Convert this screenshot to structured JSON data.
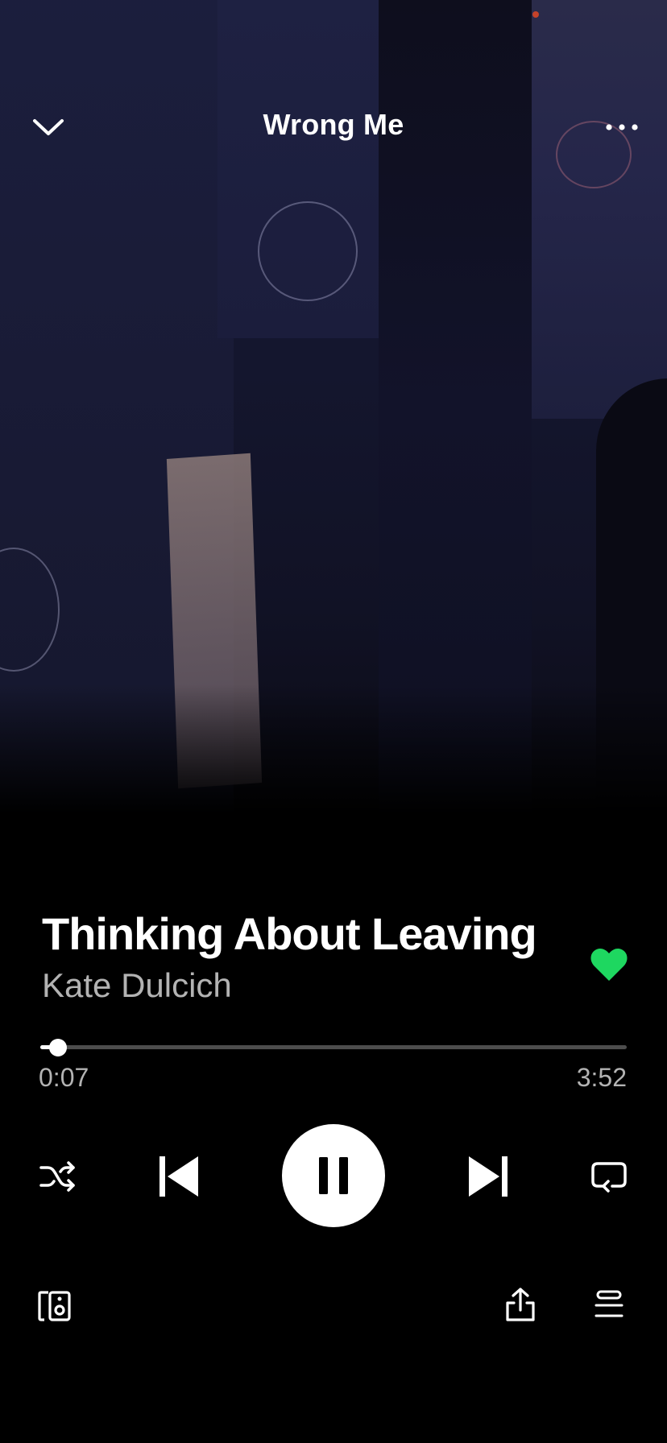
{
  "header": {
    "title": "Wrong Me",
    "collapse_icon": "chevron-down-icon",
    "more_icon": "more-options-icon"
  },
  "track": {
    "title": "Thinking About Leaving",
    "artist": "Kate Dulcich",
    "liked": true
  },
  "progress": {
    "elapsed": "0:07",
    "total": "3:52",
    "fraction": 0.03
  },
  "controls": {
    "shuffle_icon": "shuffle-icon",
    "previous_icon": "skip-previous-icon",
    "play_state": "playing",
    "pause_icon": "pause-icon",
    "next_icon": "skip-next-icon",
    "repeat_icon": "repeat-icon"
  },
  "bottom_bar": {
    "devices_icon": "connect-devices-icon",
    "share_icon": "share-icon",
    "queue_icon": "queue-icon"
  },
  "colors": {
    "background": "#000000",
    "accent_green": "#1ed760",
    "secondary_text": "#b3b3b3",
    "progress_track": "#4d4d4d"
  }
}
